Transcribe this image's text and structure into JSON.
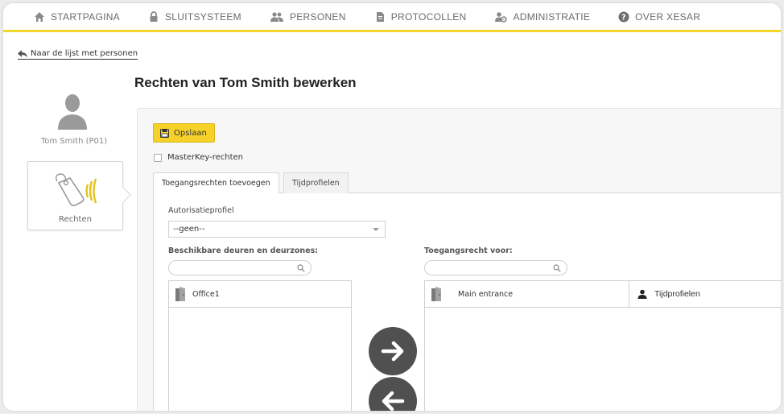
{
  "nav": {
    "items": [
      {
        "label": "STARTPAGINA",
        "icon": "home-icon"
      },
      {
        "label": "SLUITSYSTEEM",
        "icon": "lock-icon"
      },
      {
        "label": "PERSONEN",
        "icon": "people-icon"
      },
      {
        "label": "PROTOCOLLEN",
        "icon": "document-icon"
      },
      {
        "label": "ADMINISTRATIE",
        "icon": "admin-icon"
      },
      {
        "label": "OVER XESAR",
        "icon": "help-icon"
      }
    ],
    "accent_color": "#f3d62b"
  },
  "back_link": "Naar de lijst met personen",
  "page_title": "Rechten van Tom Smith bewerken",
  "person": {
    "name": "Tom Smith (P01)"
  },
  "rights_tile": {
    "label": "Rechten"
  },
  "toolbar": {
    "save_label": "Opslaan"
  },
  "masterkey": {
    "label": "MasterKey-rechten",
    "checked": false
  },
  "tabs": [
    {
      "label": "Toegangsrechten toevoegen",
      "active": true
    },
    {
      "label": "Tijdprofielen",
      "active": false
    }
  ],
  "form": {
    "auth_profile_label": "Autorisatieprofiel",
    "auth_profile_value": "--geen--",
    "available_label": "Beschikbare deuren en deurzones:",
    "assigned_label": "Toegangsrecht voor:",
    "search_left_value": "",
    "search_right_value": ""
  },
  "available_list": {
    "header": "Office1"
  },
  "assigned_list": {
    "header": "Main entrance",
    "time_profiles_header": "Tijdprofielen"
  },
  "colors": {
    "save_button": "#f5d12a",
    "round_button": "#505050"
  }
}
